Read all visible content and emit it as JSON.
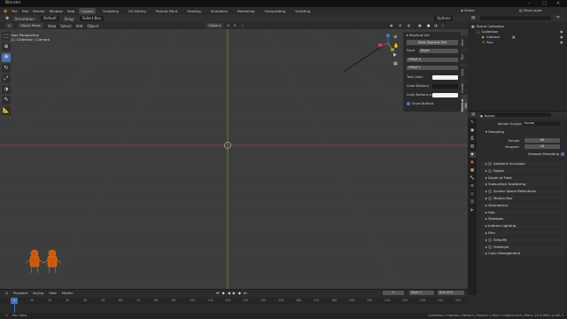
{
  "window": {
    "title": "Blender"
  },
  "menu": {
    "file": "File",
    "edit": "Edit",
    "render": "Render",
    "window": "Window",
    "help": "Help"
  },
  "workspaces": [
    "Layout",
    "Sculpting",
    "UV Editing",
    "Texture Paint",
    "Shading",
    "Animation",
    "Rendering",
    "Compositing",
    "Scripting"
  ],
  "topbar": {
    "orientation_label": "Orientation:",
    "orientation": "Default",
    "drag_label": "Drag:",
    "drag": "Select Box",
    "scene": "Scene",
    "view_layer": "View Layer"
  },
  "viewport_header": {
    "mode": "Object Mode",
    "view": "View",
    "select": "Select",
    "add": "Add",
    "object": "Object",
    "transform": "Global",
    "options": "Options"
  },
  "viewport": {
    "perspective": "User Perspective",
    "collection": "(1) Collection | Camera"
  },
  "npanel": {
    "title": "Shortcut VUr",
    "start_button": "Start Shortcut VUr",
    "dock_label": "Dock:",
    "dock": "Right",
    "offset_x": "Offset X",
    "offset_y": "Offset Y",
    "text_color": "Text Color:",
    "color_buttons": "Color Buttons:",
    "color_buttons_a": "Color Buttons a...",
    "show_buttons": "Show Buttons",
    "tabs": [
      "Item",
      "Tool",
      "View",
      "Create",
      "Edit",
      "Shortcut VUr"
    ],
    "active_tab": "Shortcut VUr"
  },
  "outliner": {
    "scene_collection": "Scene Collection",
    "items": [
      {
        "label": "Collection",
        "indent": 1,
        "icon": "collection-icon"
      },
      {
        "label": "Camera",
        "indent": 2,
        "icon": "camera-icon"
      },
      {
        "label": "Sun",
        "indent": 2,
        "icon": "light-icon"
      }
    ]
  },
  "properties": {
    "breadcrumb": "Scene",
    "render_engine_label": "Render Engine:",
    "render_engine": "Eevee",
    "sampling": "Sampling",
    "render_label": "Render",
    "render_value": "64",
    "viewport_label": "Viewport",
    "viewport_value": "16",
    "viewport_denoising": "Viewport Denoising",
    "sections": [
      {
        "label": "Ambient Occlusion",
        "checkbox": true
      },
      {
        "label": "Bloom",
        "checkbox": true
      },
      {
        "label": "Depth of Field",
        "checkbox": false
      },
      {
        "label": "Subsurface Scattering",
        "checkbox": false
      },
      {
        "label": "Screen Space Reflections",
        "checkbox": true
      },
      {
        "label": "Motion Blur",
        "checkbox": true
      },
      {
        "label": "Volumetrics",
        "checkbox": false
      },
      {
        "label": "Hair",
        "checkbox": false
      },
      {
        "label": "Shadows",
        "checkbox": false
      },
      {
        "label": "Indirect Lighting",
        "checkbox": false
      },
      {
        "label": "Film",
        "checkbox": false
      },
      {
        "label": "Simplify",
        "checkbox": true
      },
      {
        "label": "Freestyle",
        "checkbox": true
      },
      {
        "label": "Color Management",
        "checkbox": false
      }
    ]
  },
  "timeline": {
    "playback": "Playback",
    "keying": "Keying",
    "view": "View",
    "marker": "Marker",
    "current_frame": "1",
    "start_label": "Start",
    "start": "1",
    "end_label": "End",
    "end": "250",
    "ruler": [
      "0",
      "10",
      "20",
      "30",
      "40",
      "50",
      "60",
      "70",
      "80",
      "90",
      "100",
      "110",
      "120",
      "130",
      "140",
      "150",
      "160",
      "170",
      "180",
      "190",
      "200",
      "210",
      "220",
      "230",
      "240",
      "250"
    ]
  },
  "statusbar": {
    "left": "Pan View",
    "right": "Collection | Camera | Verts:0 | Faces:0 | Tris:0 | Objects:0/3 | Mem: 25.2 MiB | v2.82.7"
  },
  "colors": {
    "accent": "#4772b3",
    "x_axis": "#9b3b45",
    "y_axis": "#6a8a2c",
    "origin": "#e8a050"
  }
}
